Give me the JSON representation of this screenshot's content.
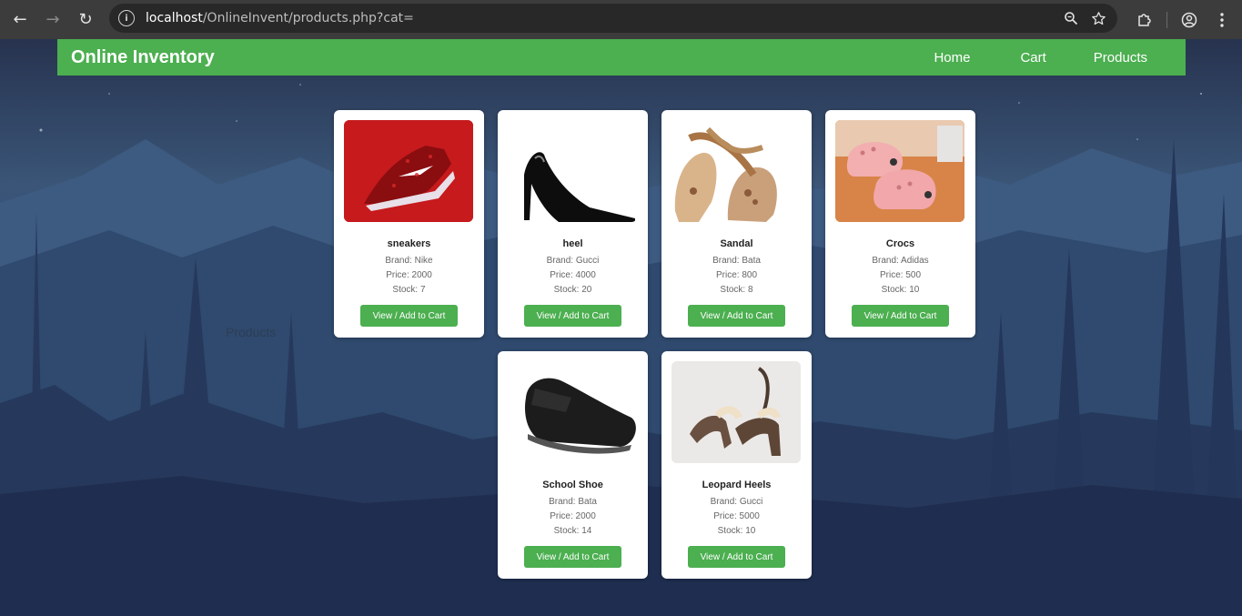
{
  "browser": {
    "url_host": "localhost",
    "url_path": "/OnlineInvent/products.php?cat="
  },
  "site": {
    "brand": "Online Inventory",
    "nav": [
      "Home",
      "Cart",
      "Products"
    ],
    "ghost_heading": "Products"
  },
  "products": [
    {
      "name": "sneakers",
      "brand": "Brand: Nike",
      "price": "Price: 2000",
      "stock": "Stock: 7",
      "button": "View / Add to Cart"
    },
    {
      "name": "heel",
      "brand": "Brand: Gucci",
      "price": "Price: 4000",
      "stock": "Stock: 20",
      "button": "View / Add to Cart"
    },
    {
      "name": "Sandal",
      "brand": "Brand: Bata",
      "price": "Price: 800",
      "stock": "Stock: 8",
      "button": "View / Add to Cart"
    },
    {
      "name": "Crocs",
      "brand": "Brand: Adidas",
      "price": "Price: 500",
      "stock": "Stock: 10",
      "button": "View / Add to Cart"
    },
    {
      "name": "School Shoe",
      "brand": "Brand: Bata",
      "price": "Price: 2000",
      "stock": "Stock: 14",
      "button": "View / Add to Cart"
    },
    {
      "name": "Leopard Heels",
      "brand": "Brand: Gucci",
      "price": "Price: 5000",
      "stock": "Stock: 10",
      "button": "View / Add to Cart"
    }
  ],
  "colors": {
    "accent": "#4caf50",
    "chrome": "#3c3c3c",
    "card": "#ffffff"
  }
}
